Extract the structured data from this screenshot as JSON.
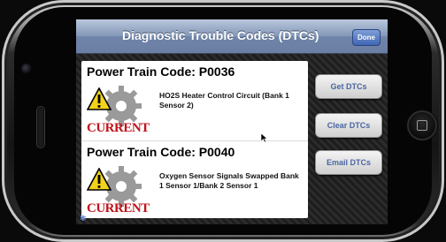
{
  "navbar": {
    "title": "Diagnostic Trouble Codes (DTCs)",
    "done_label": "Done"
  },
  "dtcs": [
    {
      "title": "Power Train Code: P0036",
      "description": "HO2S Heater Control Circuit (Bank 1 Sensor 2)",
      "status": "CURRENT"
    },
    {
      "title": "Power Train Code: P0040",
      "description": "Oxygen Sensor Signals Swapped Bank 1 Sensor 1/Bank 2 Sensor 1",
      "status": "CURRENT"
    }
  ],
  "actions": {
    "get_label": "Get DTCs",
    "clear_label": "Clear DTCs",
    "email_label": "Email DTCs"
  },
  "colors": {
    "status_red": "#c0121a",
    "button_text": "#4a66a2"
  }
}
